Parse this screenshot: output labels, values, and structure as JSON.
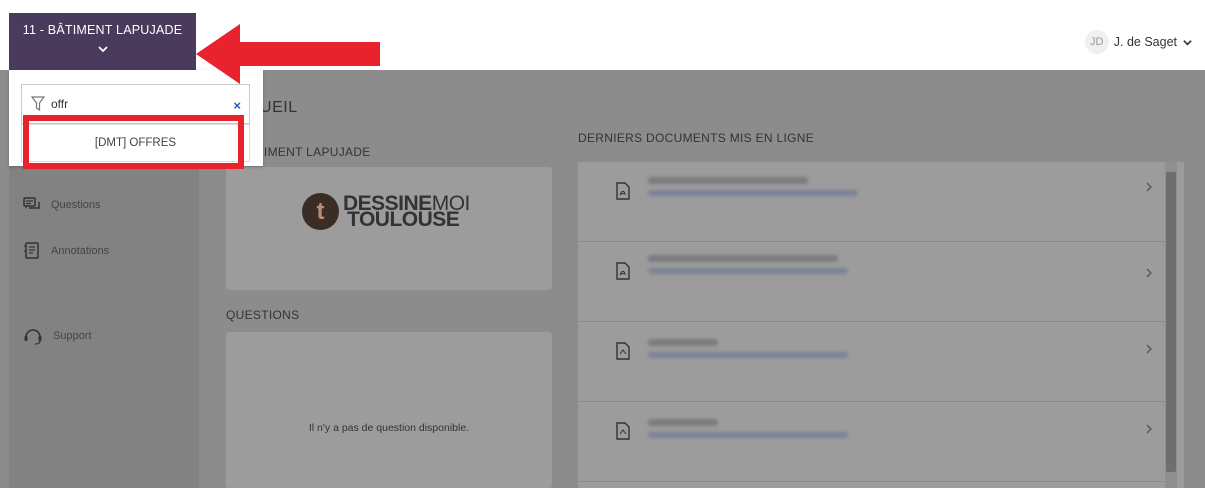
{
  "header": {
    "project_title": "11 - BÂTIMENT LAPUJADE",
    "user_initials": "JD",
    "user_name": "J. de Saget"
  },
  "dropdown": {
    "filter_value": "offr",
    "clear_label": "×",
    "option_label": "[DMT] OFFRES"
  },
  "sidebar": {
    "items": [
      {
        "label": "Questions",
        "icon": "questions-icon"
      },
      {
        "label": "Annotations",
        "icon": "annotations-icon"
      },
      {
        "label": "Support",
        "icon": "support-icon"
      }
    ]
  },
  "main": {
    "title_partial": "CUEIL",
    "project_section_partial": "ÂTIMENT LAPUJADE",
    "logo_line1_bold": "DESSINE",
    "logo_line1_thin": "MOI",
    "logo_line2": "TOULOUSE",
    "logo_mark": "t",
    "questions_title": "QUESTIONS",
    "no_question_text": "Il n'y a pas de question disponible.",
    "documents_title": "DERNIERS DOCUMENTS MIS EN LIGNE"
  },
  "documents": [
    {
      "icon": "pdf-file-icon"
    },
    {
      "icon": "pdf-file-icon"
    },
    {
      "icon": "dxf-file-icon"
    },
    {
      "icon": "dxf-file-icon"
    }
  ],
  "colors": {
    "project_bar": "#4a3a5c",
    "annotation_red": "#e8232e",
    "overlay_gray": "#8c8c8c"
  }
}
